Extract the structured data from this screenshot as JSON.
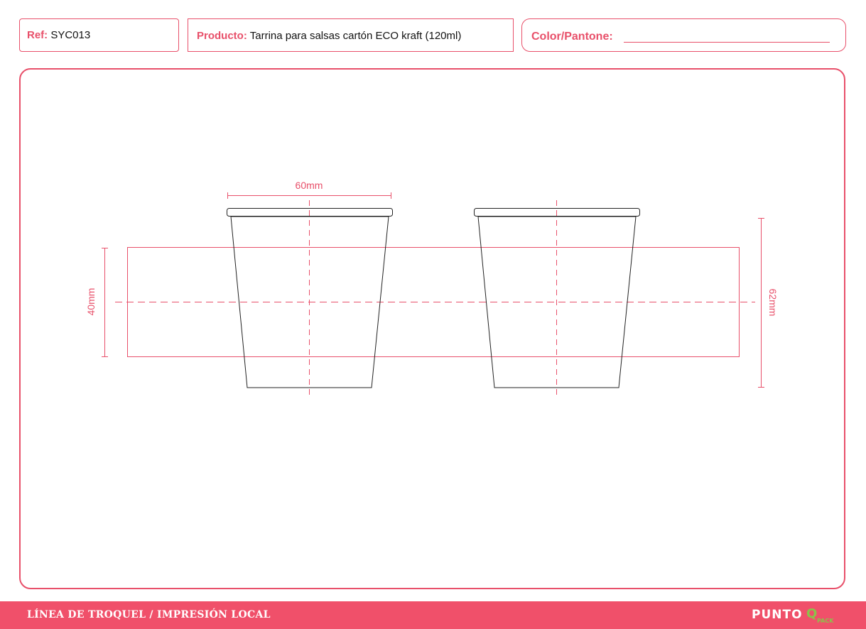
{
  "header": {
    "ref_label": "Ref:",
    "ref_value": "SYC013",
    "product_label": "Producto:",
    "product_value": "Tarrina para salsas cartón ECO kraft (120ml)",
    "color_label": "Color/Pantone:"
  },
  "drawing": {
    "width_label": "60mm",
    "print_height_label": "40mm",
    "cup_height_label": "62mm"
  },
  "footer": {
    "title": "LÍNEA DE TROQUEL / IMPRESIÓN LOCAL",
    "logo_main": "PUNTO",
    "logo_q": "Q",
    "logo_pack": "PACK"
  },
  "colors": {
    "accent": "#e8506a",
    "footer_bg": "#f0506a",
    "logo_green": "#8bc34a"
  }
}
